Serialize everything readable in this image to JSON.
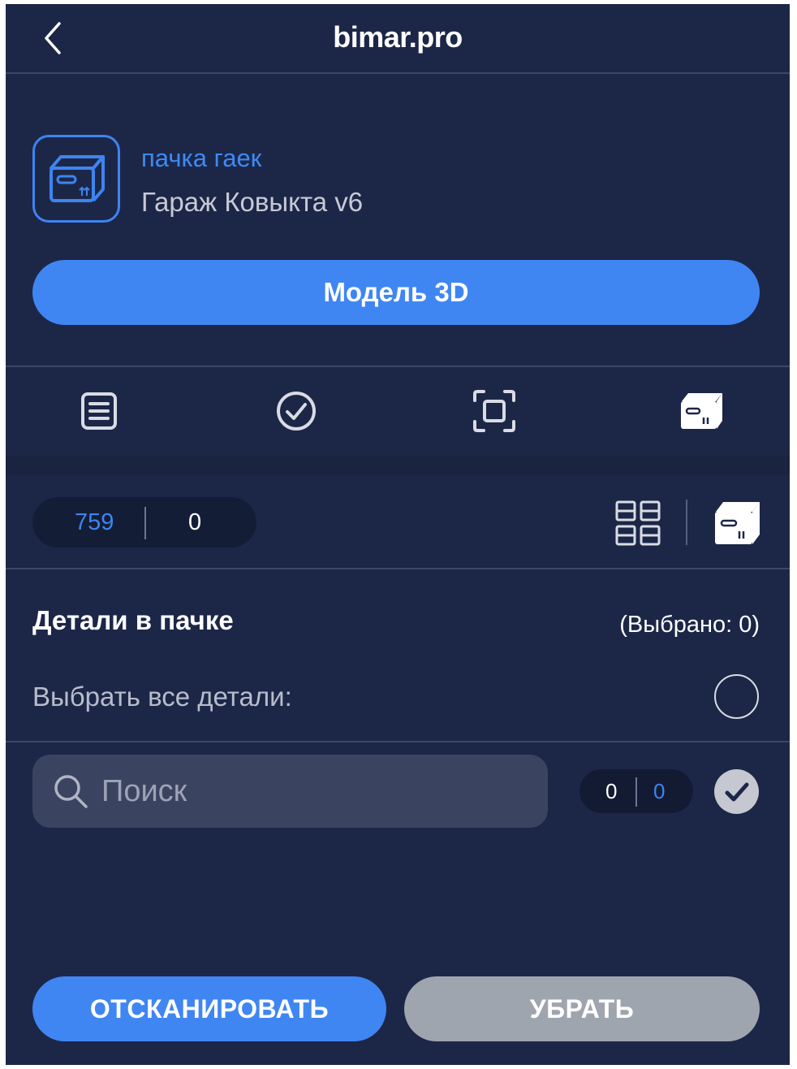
{
  "header": {
    "title": "bimar.pro",
    "back_icon": "chevron-left-icon"
  },
  "item": {
    "icon": "box-icon",
    "name": "пачка гаек",
    "project": "Гараж Ковыкта v6",
    "model_button": "Модель 3D"
  },
  "tabs": [
    {
      "icon": "document-list-icon",
      "active": false
    },
    {
      "icon": "check-circle-icon",
      "active": false
    },
    {
      "icon": "scan-frame-icon",
      "active": false
    },
    {
      "icon": "box-icon",
      "active": true
    }
  ],
  "counter": {
    "total": "759",
    "selected": "0"
  },
  "view_toggle": {
    "grid_icon": "grid-view-icon",
    "box_icon": "box-view-icon"
  },
  "section": {
    "title": "Детали в пачке",
    "selected_label": "(Выбрано: 0)",
    "select_all_label": "Выбрать все детали:"
  },
  "search": {
    "placeholder": "Поиск",
    "value": "",
    "icon": "search-icon"
  },
  "mini_counter": {
    "a": "0",
    "b": "0"
  },
  "footer": {
    "scan_button": "ОТСКАНИРОВАТЬ",
    "remove_button": "УБРАТЬ"
  },
  "colors": {
    "background": "#1c2748",
    "accent": "#3f86f3",
    "disabled": "#9fa5ae"
  }
}
